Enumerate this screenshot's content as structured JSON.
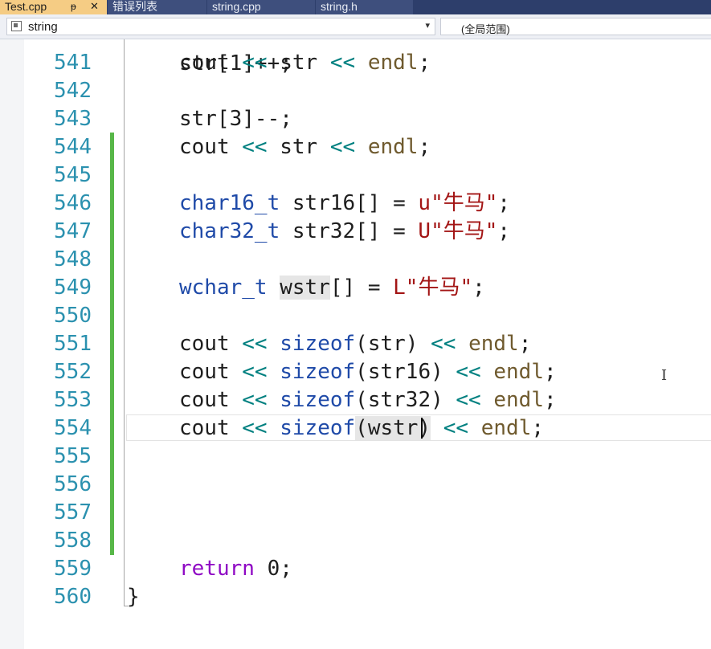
{
  "tabs": [
    {
      "label": "Test.cpp",
      "pin": "ᵽ",
      "close": "✕",
      "active": true
    },
    {
      "label": "错误列表",
      "active": false
    },
    {
      "label": "string.cpp",
      "active": false
    },
    {
      "label": "string.h",
      "active": false
    }
  ],
  "navbar": {
    "scope": "string",
    "scope_arrow": "▾",
    "member": "(全局范围)"
  },
  "editor": {
    "partial_line": "str[1]++;",
    "lines": [
      {
        "num": "541",
        "code": "cout << str << endl;"
      },
      {
        "num": "542",
        "code": ""
      },
      {
        "num": "543",
        "code": "str[3]--;"
      },
      {
        "num": "544",
        "code": "cout << str << endl;"
      },
      {
        "num": "545",
        "code": ""
      },
      {
        "num": "546",
        "code": "char16_t str16[] = u\"牛马\";"
      },
      {
        "num": "547",
        "code": "char32_t str32[] = U\"牛马\";"
      },
      {
        "num": "548",
        "code": ""
      },
      {
        "num": "549",
        "code": "wchar_t wstr[] = L\"牛马\";"
      },
      {
        "num": "550",
        "code": ""
      },
      {
        "num": "551",
        "code": "cout << sizeof(str) << endl;"
      },
      {
        "num": "552",
        "code": "cout << sizeof(str16) << endl;"
      },
      {
        "num": "553",
        "code": "cout << sizeof(str32) << endl;"
      },
      {
        "num": "554",
        "code": "cout << sizeof(wstr) << endl;"
      },
      {
        "num": "555",
        "code": ""
      },
      {
        "num": "556",
        "code": ""
      },
      {
        "num": "557",
        "code": ""
      },
      {
        "num": "558",
        "code": ""
      },
      {
        "num": "559",
        "code": "return 0;"
      },
      {
        "num": "560",
        "code": "}"
      }
    ],
    "cursor_line": "554"
  },
  "icons": {
    "scope": "class-scope-icon",
    "ibeam": "text-cursor-icon"
  },
  "colors": {
    "tabbar": "#2d3e6b",
    "active_tab": "#f5cc84",
    "line_number": "#2b91af",
    "keyword": "#1f4aa8",
    "operator": "#008080",
    "string": "#a31515",
    "return_keyword": "#8f08c4",
    "change_bar": "#57b748"
  }
}
